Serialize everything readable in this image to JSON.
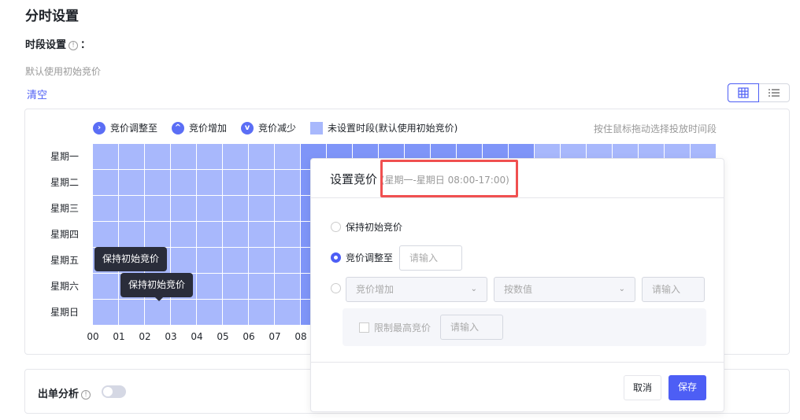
{
  "page": {
    "title": "分时设置",
    "section": "时段设置",
    "colon": "：",
    "hint": "默认使用初始竞价",
    "clear": "清空"
  },
  "view_switch": {
    "grid_icon": "grid-icon",
    "list_icon": "list-icon",
    "active": "grid"
  },
  "legend": {
    "adjust": "竞价调整至",
    "increase": "竞价增加",
    "decrease": "竞价减少",
    "unset": "未设置时段(默认使用初始竞价)",
    "drag_hint": "按住鼠标拖动选择投放时间段"
  },
  "colors": {
    "unset": "#a8b8fc",
    "selected": "#7f95f8",
    "accent": "#4d5ef5"
  },
  "schedule": {
    "days": [
      "星期一",
      "星期二",
      "星期三",
      "星期四",
      "星期五",
      "星期六",
      "星期日"
    ],
    "hours_visible": [
      "00",
      "01",
      "02",
      "03",
      "04",
      "05",
      "06",
      "07",
      "08"
    ],
    "selected_hours": [
      8,
      9,
      10,
      11,
      12,
      13,
      14,
      15,
      16
    ]
  },
  "tooltips": [
    "保持初始竞价",
    "保持初始竞价"
  ],
  "order_analysis": {
    "label": "出单分析",
    "enabled": false
  },
  "dialog": {
    "title": "设置竞价",
    "range": "(星期一-星期日 08:00-17:00)",
    "opt_keep": "保持初始竞价",
    "opt_adjust": "竞价调整至",
    "adjust_placeholder": "请输入",
    "mode_select": "竞价增加",
    "unit_select": "按数值",
    "value_placeholder": "请输入",
    "limit_label": "限制最高竞价",
    "limit_placeholder": "请输入",
    "selected_option": "adjust",
    "cancel": "取消",
    "save": "保存"
  }
}
